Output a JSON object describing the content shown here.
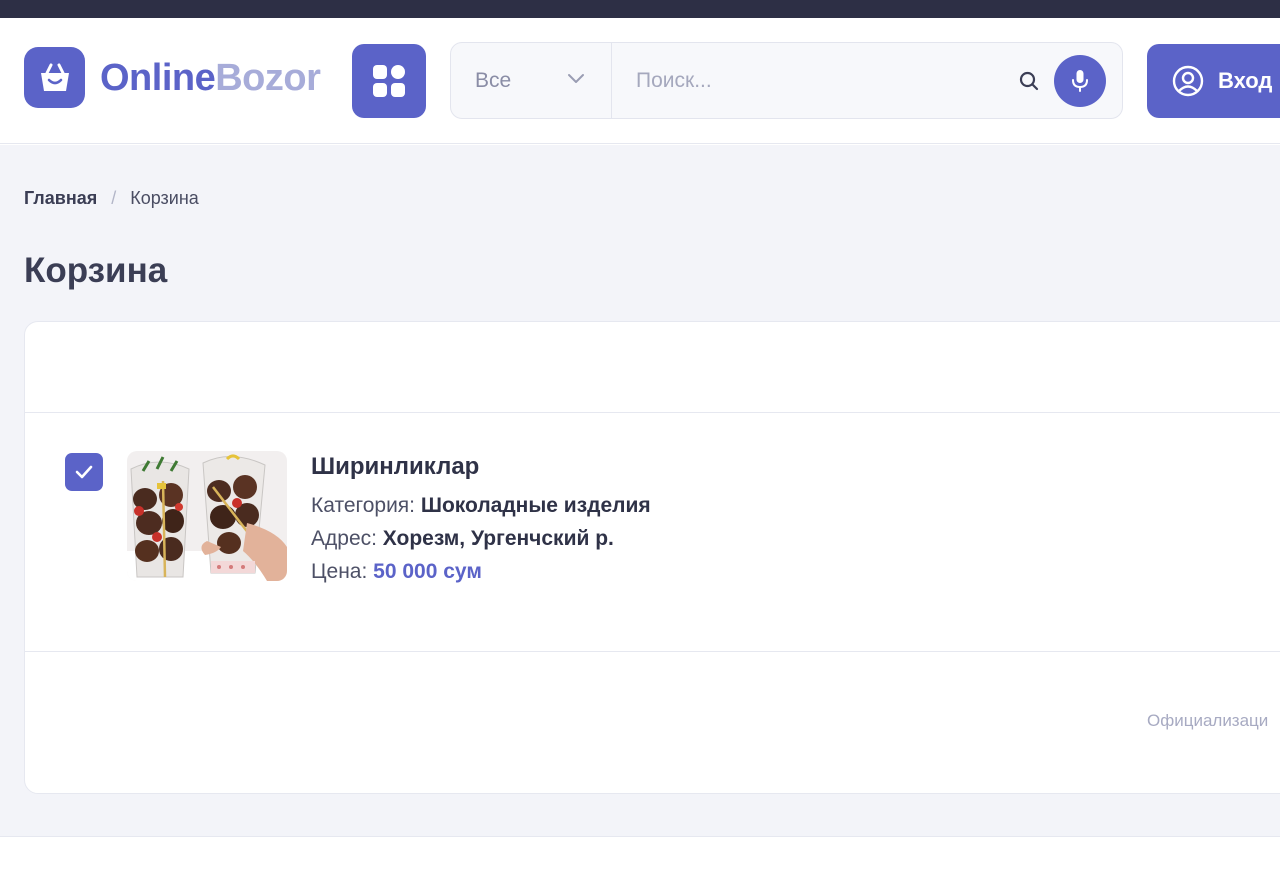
{
  "logo": {
    "text_primary": "Online",
    "text_secondary": "Bozor"
  },
  "search": {
    "category_selected": "Все",
    "placeholder": "Поиск..."
  },
  "header": {
    "login_label": "Вход"
  },
  "breadcrumb": {
    "home": "Главная",
    "separator": "/",
    "current": "Корзина"
  },
  "page": {
    "title": "Корзина"
  },
  "cart": {
    "item": {
      "title": "Ширинликлар",
      "category_label": "Категория:",
      "category_value": "Шоколадные изделия",
      "address_label": "Адрес:",
      "address_value": "Хорезм, Ургенчский р.",
      "price_label": "Цена:",
      "price_value": "50 000 сум",
      "checked": true
    },
    "checkout_label": "Официализаци"
  },
  "colors": {
    "accent": "#5b63c8",
    "accent_light": "#a7acd9",
    "background": "#f3f4f9",
    "topbar": "#2d2f45"
  },
  "icons": [
    "shopping-bag-icon",
    "grid-icon",
    "chevron-down-icon",
    "search-icon",
    "microphone-icon",
    "user-circle-icon",
    "check-icon"
  ]
}
